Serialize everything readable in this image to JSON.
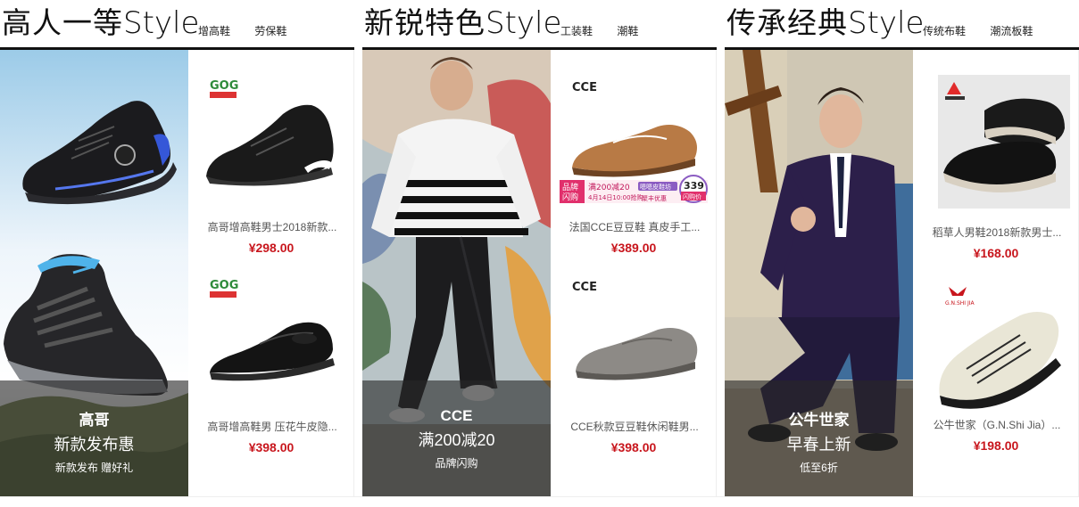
{
  "sections": [
    {
      "title_cn": "高人一等",
      "title_en": "Style",
      "links": [
        "增高鞋",
        "劳保鞋"
      ],
      "promo": {
        "brand": "高哥",
        "headline": "新款发布惠",
        "sub": "新款发布 赠好礼"
      },
      "products": [
        {
          "logo": "GOG",
          "name": "高哥增高鞋男士2018新款...",
          "price": "¥298.00"
        },
        {
          "logo": "GOG",
          "name": "高哥增高鞋男 压花牛皮隐...",
          "price": "¥398.00"
        }
      ]
    },
    {
      "title_cn": "新锐特色",
      "title_en": "Style",
      "links": [
        "工装鞋",
        "潮鞋"
      ],
      "promo": {
        "brand": "CCE",
        "headline": "满200减20",
        "sub": "品牌闪购"
      },
      "products": [
        {
          "logo": "CCE",
          "name": "法国CCE豆豆鞋 真皮手工...",
          "price": "¥389.00",
          "badge": {
            "tag1": "品牌",
            "tag2": "闪购",
            "deal": "满200减20",
            "date": "4月14日10:00抢购",
            "btn": "嗯嗯皮鞋坊",
            "more": "聚丰优惠",
            "num": "339",
            "unit": "闪购价"
          }
        },
        {
          "logo": "CCE",
          "name": "CCE秋款豆豆鞋休闲鞋男...",
          "price": "¥398.00"
        }
      ]
    },
    {
      "title_cn": "传承经典",
      "title_en": "Style",
      "links": [
        "传统布鞋",
        "潮流板鞋"
      ],
      "promo": {
        "brand": "公牛世家",
        "headline": "早春上新",
        "sub": "低至6折"
      },
      "products": [
        {
          "logo": "",
          "name": "稻草人男鞋2018新款男士...",
          "price": "¥168.00"
        },
        {
          "logo": "G.N.SHI JIA",
          "name": "公牛世家（G.N.Shi Jia）...",
          "price": "¥198.00"
        }
      ]
    }
  ]
}
